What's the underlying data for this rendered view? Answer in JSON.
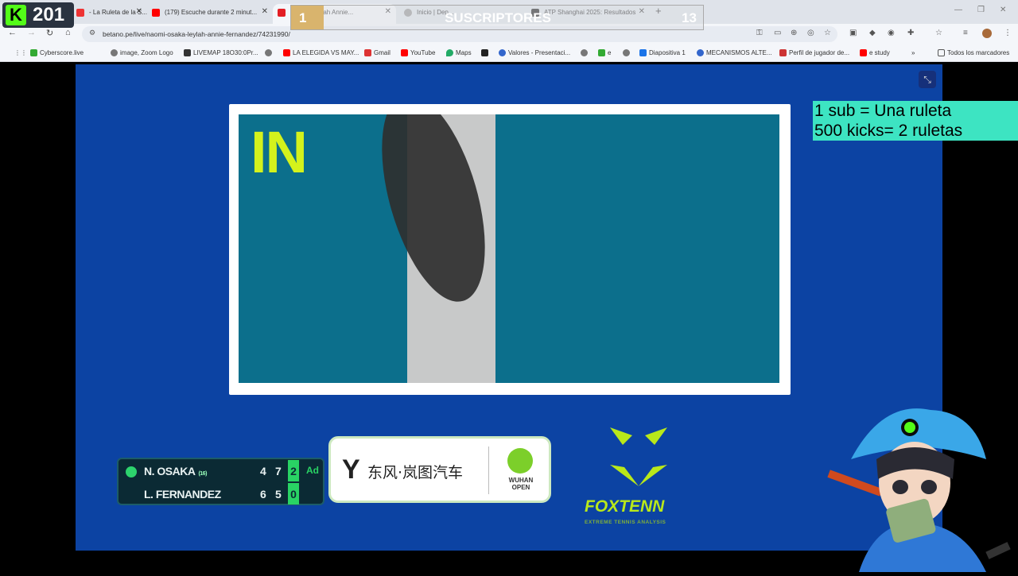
{
  "browser": {
    "tabs": [
      {
        "label": "- La Ruleta de la S...",
        "icon_color": "#e33"
      },
      {
        "label": "(179) Escuche durante 2 minut...",
        "icon_color": "#f00"
      },
      {
        "label": "...aka - Leylah Annie...",
        "icon_color": "#e31e24"
      },
      {
        "label": "Inicio | Dep...",
        "icon_color": "#999"
      },
      {
        "label": "ATP Shanghai 2025: Resultados",
        "icon_color": "#222"
      }
    ],
    "new_tab": "+",
    "url": "betano.pe/live/naomi-osaka-leylah-annie-fernandez/74231990/",
    "bookmarks": [
      {
        "label": "Cyberscore.live",
        "color": "#3a3"
      },
      {
        "label": "image, Zoom Logo",
        "color": "#777"
      },
      {
        "label": "LIVEMAP 18O30:0Pr...",
        "color": "#333"
      },
      {
        "label": "",
        "color": "#777"
      },
      {
        "label": "LA ELEGIDA VS MAY...",
        "color": "#f00"
      },
      {
        "label": "Gmail",
        "color": "#d33"
      },
      {
        "label": "YouTube",
        "color": "#f00"
      },
      {
        "label": "Maps",
        "color": "#2a6"
      },
      {
        "label": "",
        "color": "#222"
      },
      {
        "label": "Valores - Presentaci...",
        "color": "#36c"
      },
      {
        "label": "",
        "color": "#777"
      },
      {
        "label": "e",
        "color": "#3a3"
      },
      {
        "label": "",
        "color": "#777"
      },
      {
        "label": "Diapositiva 1",
        "color": "#1a73e8"
      },
      {
        "label": "MECANISMOS ALTE...",
        "color": "#36c"
      },
      {
        "label": "Perfil de jugador de...",
        "color": "#c33"
      },
      {
        "label": "e study",
        "color": "#f00"
      }
    ],
    "bookmarks_more": "»",
    "all_bookmarks": "Todos los marcadores"
  },
  "overlay": {
    "kick_logo": "K",
    "kick_count": "201",
    "subs_current": "1",
    "subs_label": "SUSCRIPTORES",
    "subs_goal": "13",
    "subs_progress": 0.08,
    "promo_line1": "1 sub = Una ruleta",
    "promo_line2": "500 kicks= 2 ruletas"
  },
  "replay": {
    "call": "IN"
  },
  "scoreboard": {
    "players": [
      {
        "name": "N. OSAKA",
        "seed": "(16)",
        "set1": "4",
        "set2": "7",
        "set3": "2",
        "point": "Ad"
      },
      {
        "name": "L. FERNANDEZ",
        "seed": "",
        "set1": "6",
        "set2": "5",
        "set3": "0",
        "point": ""
      }
    ]
  },
  "sponsor": {
    "name_cn": "东风·岚图汽车",
    "event_line1": "WUHAN",
    "event_line2": "OPEN"
  },
  "foxtenn": {
    "brand": "FOXTENN",
    "tagline": "EXTREME TENNIS ANALYSIS"
  }
}
